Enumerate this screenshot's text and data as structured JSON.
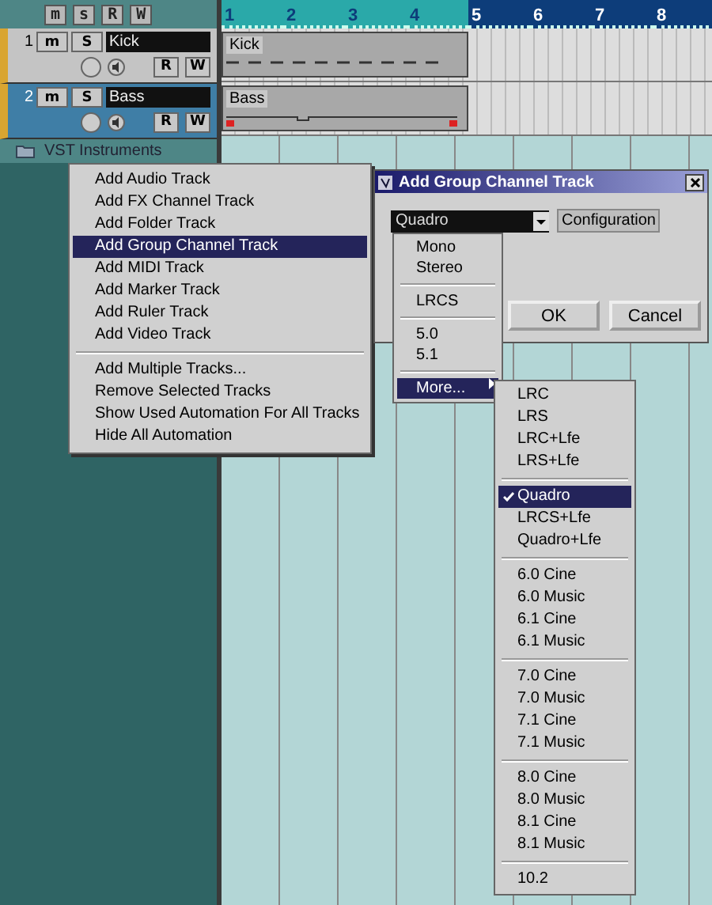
{
  "track_header": {
    "buttons": [
      "m",
      "s",
      "R",
      "W"
    ]
  },
  "tracks": [
    {
      "number": "1",
      "name": "Kick",
      "selected": false,
      "buttons": [
        "m",
        "S",
        "R",
        "W"
      ]
    },
    {
      "number": "2",
      "name": "Bass",
      "selected": true,
      "buttons": [
        "m",
        "S",
        "R",
        "W"
      ]
    }
  ],
  "folder": {
    "name": "VST Instruments"
  },
  "ruler": {
    "marks": [
      {
        "label": "1",
        "in_range": true
      },
      {
        "label": "2",
        "in_range": true
      },
      {
        "label": "3",
        "in_range": true
      },
      {
        "label": "4",
        "in_range": true
      },
      {
        "label": "5",
        "in_range": false
      },
      {
        "label": "6",
        "in_range": false
      },
      {
        "label": "7",
        "in_range": false
      },
      {
        "label": "8",
        "in_range": false
      }
    ]
  },
  "parts": [
    {
      "name": "Kick",
      "kind": "midi"
    },
    {
      "name": "Bass",
      "kind": "automation"
    }
  ],
  "context_menu": {
    "groups": [
      [
        {
          "label": "Add Audio Track",
          "selected": false
        },
        {
          "label": "Add FX Channel Track",
          "selected": false
        },
        {
          "label": "Add Folder Track",
          "selected": false
        },
        {
          "label": "Add Group Channel Track",
          "selected": true
        },
        {
          "label": "Add MIDI Track",
          "selected": false
        },
        {
          "label": "Add Marker Track",
          "selected": false
        },
        {
          "label": "Add Ruler Track",
          "selected": false
        },
        {
          "label": "Add Video Track",
          "selected": false
        }
      ],
      [
        {
          "label": "Add Multiple Tracks...",
          "selected": false
        },
        {
          "label": "Remove Selected Tracks",
          "selected": false
        },
        {
          "label": "Show Used Automation For All Tracks",
          "selected": false
        },
        {
          "label": "Hide All Automation",
          "selected": false
        }
      ]
    ]
  },
  "dialog": {
    "title": "Add Group Channel Track",
    "dropdown_value": "Quadro",
    "configuration_button": "Configuration",
    "buttons": [
      "OK",
      "Cancel"
    ]
  },
  "dropdown_list": {
    "groups": [
      [
        {
          "label": "Mono",
          "selected": false,
          "kind": "item"
        },
        {
          "label": "Stereo",
          "selected": false,
          "kind": "item"
        }
      ],
      [
        {
          "label": "LRCS",
          "selected": false,
          "kind": "item"
        }
      ],
      [
        {
          "label": "5.0",
          "selected": false,
          "kind": "item"
        },
        {
          "label": "5.1",
          "selected": false,
          "kind": "item"
        }
      ],
      [
        {
          "label": "More...",
          "selected": true,
          "kind": "submenu"
        }
      ]
    ]
  },
  "submenu": {
    "groups": [
      [
        {
          "label": "LRC",
          "checked": false
        },
        {
          "label": "LRS",
          "checked": false
        },
        {
          "label": "LRC+Lfe",
          "checked": false
        },
        {
          "label": "LRS+Lfe",
          "checked": false
        }
      ],
      [
        {
          "label": "Quadro",
          "checked": true
        },
        {
          "label": "LRCS+Lfe",
          "checked": false
        },
        {
          "label": "Quadro+Lfe",
          "checked": false
        }
      ],
      [
        {
          "label": "6.0 Cine",
          "checked": false
        },
        {
          "label": "6.0 Music",
          "checked": false
        },
        {
          "label": "6.1 Cine",
          "checked": false
        },
        {
          "label": "6.1 Music",
          "checked": false
        }
      ],
      [
        {
          "label": "7.0 Cine",
          "checked": false
        },
        {
          "label": "7.0 Music",
          "checked": false
        },
        {
          "label": "7.1 Cine",
          "checked": false
        },
        {
          "label": "7.1 Music",
          "checked": false
        }
      ],
      [
        {
          "label": "8.0 Cine",
          "checked": false
        },
        {
          "label": "8.0 Music",
          "checked": false
        },
        {
          "label": "8.1 Cine",
          "checked": false
        },
        {
          "label": "8.1 Music",
          "checked": false
        }
      ],
      [
        {
          "label": "10.2",
          "checked": false
        }
      ]
    ]
  }
}
